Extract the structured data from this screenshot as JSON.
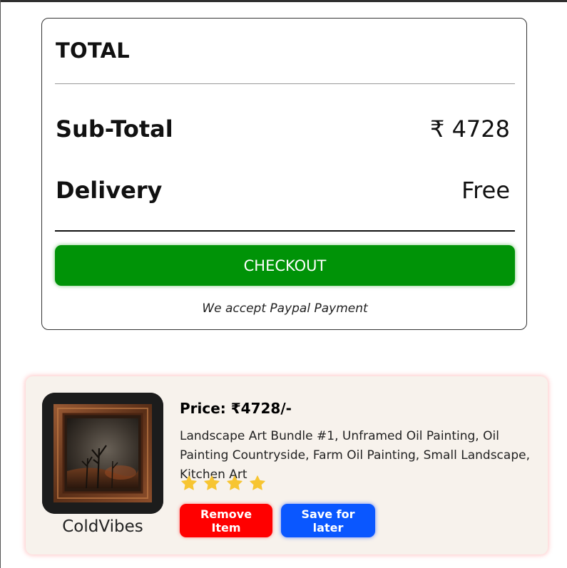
{
  "summary": {
    "title": "TOTAL",
    "subtotal_label": "Sub-Total",
    "subtotal_value": "₹ 4728",
    "delivery_label": "Delivery",
    "delivery_value": "Free",
    "checkout_label": "CHECKOUT",
    "payment_note": "We accept Paypal Payment",
    "checkout_color": "#009307"
  },
  "cart_item": {
    "image_icon": "framed-oil-painting-image",
    "seller": "ColdVibes",
    "price": "Price: ₹4728/-",
    "description": "Landscape Art Bundle #1, Unframed Oil Painting, Oil Painting Countryside, Farm Oil Painting, Small Landscape, Kitchen Art",
    "rating": 4,
    "rating_max": 4,
    "star_color": "#f7c531",
    "remove_label": "Remove Item",
    "save_label": "Save for later",
    "remove_color": "#ff0000",
    "save_color": "#0a57ff"
  }
}
